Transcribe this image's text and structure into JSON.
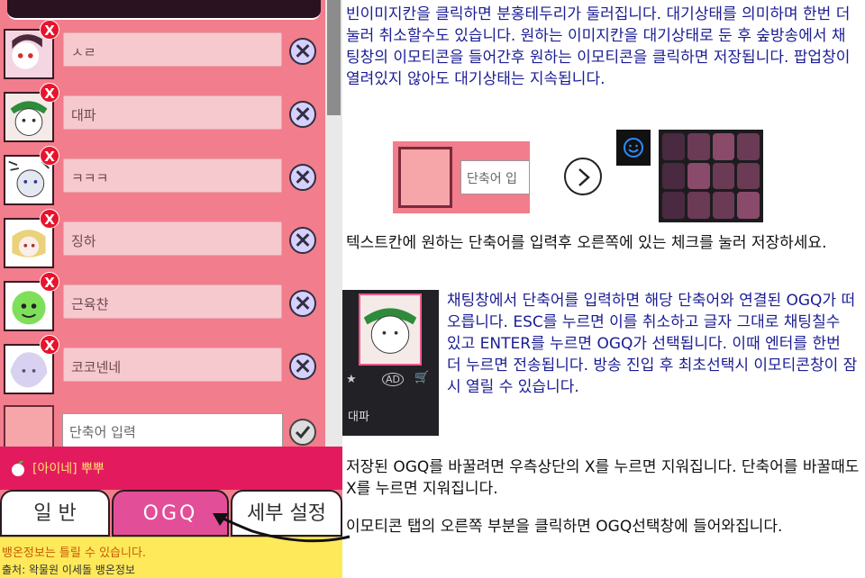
{
  "left_panel": {
    "rows": [
      {
        "label": "ㅅㄹ"
      },
      {
        "label": "대파"
      },
      {
        "label": "ㅋㅋㅋ"
      },
      {
        "label": "징하"
      },
      {
        "label": "근육챤"
      },
      {
        "label": "코코넨네"
      }
    ],
    "delete_badge": "X",
    "new_input_placeholder": "단축어 입력",
    "username": "[아이네] 뿌뿌",
    "tabs": {
      "general": "일 반",
      "ogq": "OGQ",
      "settings": "세부 설정"
    },
    "footer_line1": "뱅온정보는 틀릴 수 있습니다.",
    "footer_line2": "출처: 왁물원 이세돌 뱅온정보"
  },
  "article": {
    "p1": "빈이미지칸을 클릭하면 분홍테두리가 둘러집니다. 대기상태를 의미하며 한번 더 눌러 취소할수도 있습니다. 원하는 이미지칸을 대기상태로 둔 후 숲방송에서 채팅창의 이모티콘을 들어간후 원하는 이모티콘을 클릭하면 저장됩니다. 팝업창이 열려있지 않아도 대기상태는 지속됩니다.",
    "demo_input": "단축어 입",
    "p2": "텍스트칸에 원하는 단축어를 입력후 오른쪽에 있는 체크를 눌러 저장하세요.",
    "p3": "채팅창에서 단축어를 입력하면 해당 단축어와 연결된 OGQ가 떠오릅니다. ESC를 누르면 이를 취소하고 글자 그대로 채팅칠수 있고 ENTER를 누르면 OGQ가 선택됩니다. 이때 엔터를 한번 더 누르면 전송됩니다. 방송 진입 후 최초선택시 이모티콘창이 잠시 열릴 수 있습니다.",
    "popup_label": "대파",
    "p4": "저장된 OGQ를 바꿀려면 우측상단의 X를 누르면 지워집니다. 단축어를 바꿀때도 X를 누르면 지워집니다.",
    "p5": "이모티콘 탭의 오른쪽 부분을 클릭하면 OGQ선택창에 들어와집니다."
  },
  "colors": {
    "panel": "#f27d8c",
    "accent": "#e34e98",
    "userbar": "#e31b5e",
    "text_blue": "#1b1d93",
    "footer": "#fde95a"
  }
}
